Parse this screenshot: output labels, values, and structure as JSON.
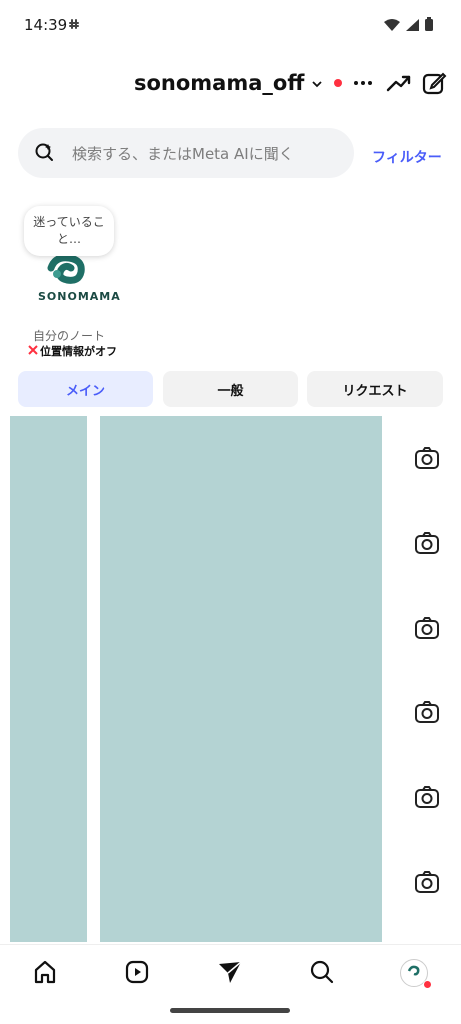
{
  "status": {
    "time": "14:39",
    "slack_icon": "slack-icon"
  },
  "header": {
    "account_name": "sonomama_off"
  },
  "search": {
    "placeholder": "検索する、またはMeta AIに聞く",
    "filter_label": "フィルター"
  },
  "notes": {
    "bubble_text": "迷っていること…",
    "logo_text": "SONOMAMA",
    "label": "自分のノート",
    "location_text": "位置情報がオフ"
  },
  "tabs": [
    {
      "label": "メイン",
      "active": true
    },
    {
      "label": "一般",
      "active": false
    },
    {
      "label": "リクエスト",
      "active": false
    }
  ],
  "colors": {
    "accent": "#4a5df9",
    "placeholder_panel": "#b4d3d3",
    "notification": "#ff3040"
  },
  "nav": [
    "home-icon",
    "reels-icon",
    "messages-icon",
    "search-icon",
    "profile-avatar"
  ]
}
